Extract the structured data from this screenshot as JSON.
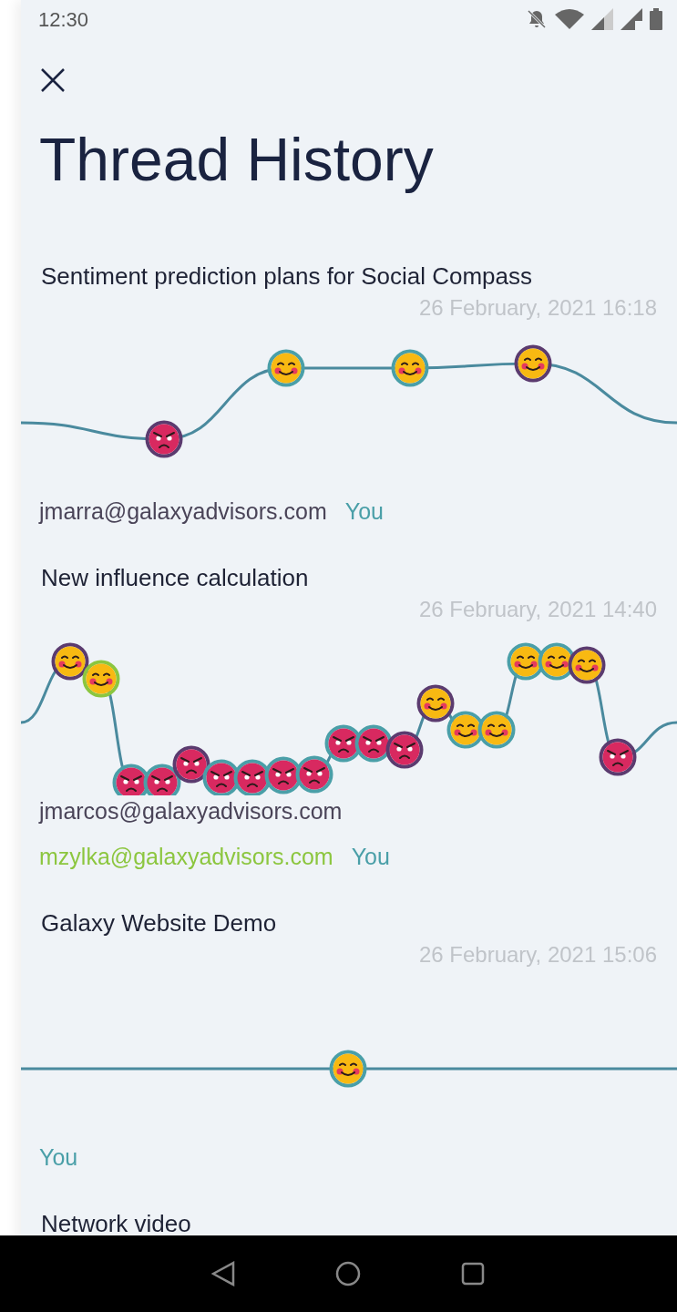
{
  "status_bar": {
    "time": "12:30"
  },
  "title": "Thread History",
  "threads": [
    {
      "title": "Sentiment prediction plans for Social Compass",
      "date": "26 February, 2021 16:18",
      "points": [
        {
          "kind": "angry",
          "color": "#5b3b6f"
        },
        {
          "kind": "happy",
          "color": "#4a9fa8"
        },
        {
          "kind": "happy",
          "color": "#4a9fa8"
        },
        {
          "kind": "happy",
          "color": "#5b3b6f"
        }
      ],
      "participants": [
        {
          "name": "jmarra@galaxyadvisors.com",
          "color": "#4a4458"
        },
        {
          "name": "You",
          "color": "#4a9fa8"
        }
      ]
    },
    {
      "title": "New influence calculation",
      "date": "26 February, 2021 14:40",
      "points": [
        {
          "kind": "happy",
          "color": "#5b3b6f"
        },
        {
          "kind": "happy",
          "color": "#8cc63f"
        },
        {
          "kind": "angry",
          "color": "#4a9fa8"
        },
        {
          "kind": "angry",
          "color": "#4a9fa8"
        },
        {
          "kind": "angry",
          "color": "#5b3b6f"
        },
        {
          "kind": "angry",
          "color": "#4a9fa8"
        },
        {
          "kind": "angry",
          "color": "#4a9fa8"
        },
        {
          "kind": "angry",
          "color": "#4a9fa8"
        },
        {
          "kind": "angry",
          "color": "#4a9fa8"
        },
        {
          "kind": "angry",
          "color": "#4a9fa8"
        },
        {
          "kind": "angry",
          "color": "#4a9fa8"
        },
        {
          "kind": "angry",
          "color": "#5b3b6f"
        },
        {
          "kind": "happy",
          "color": "#5b3b6f"
        },
        {
          "kind": "happy",
          "color": "#4a9fa8"
        },
        {
          "kind": "happy",
          "color": "#4a9fa8"
        },
        {
          "kind": "happy",
          "color": "#4a9fa8"
        },
        {
          "kind": "happy",
          "color": "#4a9fa8"
        },
        {
          "kind": "happy",
          "color": "#5b3b6f"
        },
        {
          "kind": "angry",
          "color": "#5b3b6f"
        }
      ],
      "participants": [
        {
          "name": "jmarcos@galaxyadvisors.com",
          "color": "#4a4458"
        },
        {
          "name": "mzylka@galaxyadvisors.com",
          "color": "#8cc63f"
        },
        {
          "name": "You",
          "color": "#4a9fa8"
        }
      ]
    },
    {
      "title": "Galaxy Website Demo",
      "date": "26 February, 2021 15:06",
      "points": [
        {
          "kind": "happy",
          "color": "#4a9fa8"
        }
      ],
      "participants": [
        {
          "name": "You",
          "color": "#4a9fa8"
        }
      ]
    },
    {
      "title": "Network video"
    }
  ]
}
